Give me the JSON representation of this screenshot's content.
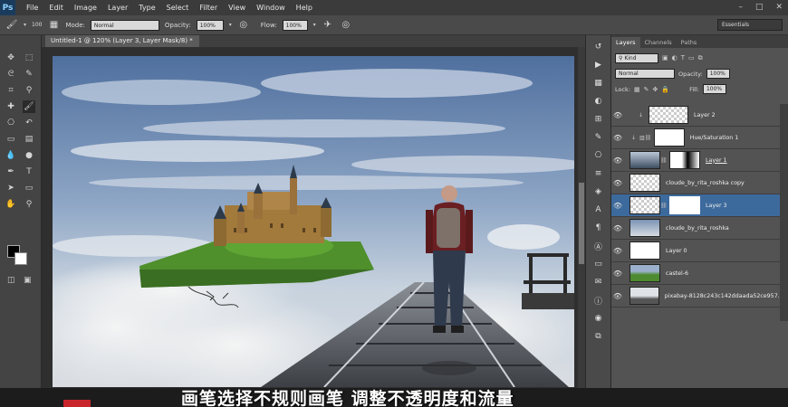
{
  "app": {
    "logo": "Ps",
    "menu": [
      "File",
      "Edit",
      "Image",
      "Layer",
      "Type",
      "Select",
      "Filter",
      "View",
      "Window",
      "Help"
    ],
    "window_controls": [
      "–",
      "□",
      "✕"
    ]
  },
  "options": {
    "brush_size": "100",
    "mode_label": "Mode:",
    "mode_value": "Normal",
    "opacity_label": "Opacity:",
    "opacity_value": "100%",
    "flow_label": "Flow:",
    "flow_value": "100%",
    "workspace": "Essentials"
  },
  "document": {
    "tab_title": "Untitled-1 @ 120% (Layer 3, Layer Mask/8) *"
  },
  "panel": {
    "tabs": [
      "Layers",
      "Channels",
      "Paths"
    ],
    "kind_value": "Kind",
    "blend_mode": "Normal",
    "opacity_label": "Opacity:",
    "opacity_value": "100%",
    "lock_label": "Lock:",
    "fill_label": "Fill:",
    "fill_value": "100%",
    "layers": [
      {
        "name": "Layer 2"
      },
      {
        "name": "Hue/Saturation 1"
      },
      {
        "name": "Layer 1"
      },
      {
        "name": "cloude_by_rita_roshka copy"
      },
      {
        "name": "Layer 3"
      },
      {
        "name": "cloude_by_rita_roshka"
      },
      {
        "name": "Layer 0"
      },
      {
        "name": "castel-6"
      },
      {
        "name": "pixabay-8128c243c142ddaada52ce957..."
      }
    ]
  },
  "subtitle": "画笔选择不规则画笔 调整不透明度和流量",
  "colors": {
    "selected_layer": "#3d6a9c",
    "panel_bg": "#535353",
    "menubar_bg": "#3b3b3b"
  }
}
